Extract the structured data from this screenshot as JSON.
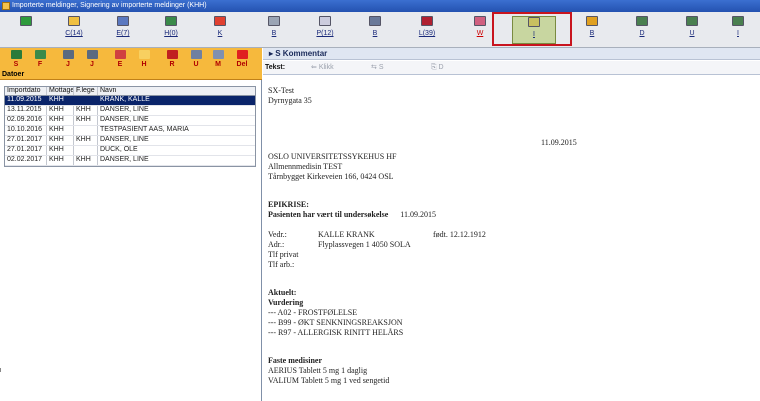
{
  "window": {
    "title": "Importerte meldinger, Signering av importerte meldinger (KHH)"
  },
  "toolbar": {
    "buttons": [
      {
        "label": ""
      },
      {
        "label": "C(14)"
      },
      {
        "label": "E(7)"
      },
      {
        "label": "H(0)"
      },
      {
        "label": "K"
      },
      {
        "label": "B"
      },
      {
        "label": "P(12)"
      },
      {
        "label": "B"
      },
      {
        "label": "L(39)"
      },
      {
        "label": "W"
      },
      {
        "label": "I"
      },
      {
        "label": "B"
      },
      {
        "label": "D"
      },
      {
        "label": "U"
      },
      {
        "label": "I"
      }
    ]
  },
  "left_toolbar": {
    "buttons": [
      {
        "label": "S"
      },
      {
        "label": "F"
      },
      {
        "label": "J"
      },
      {
        "label": "J"
      },
      {
        "label": "E"
      },
      {
        "label": "H"
      },
      {
        "label": "R"
      },
      {
        "label": "U"
      },
      {
        "label": "M"
      },
      {
        "label": "Del"
      }
    ],
    "section_label": "Datoer"
  },
  "grid": {
    "columns": [
      "Importdato",
      "Mottager",
      "F.lege",
      "Navn"
    ],
    "rows": [
      {
        "date": "11.09.2015",
        "mottager": "KHH",
        "flege": "",
        "navn": "KRANK, KALLE",
        "selected": true
      },
      {
        "date": "13.11.2015",
        "mottager": "KHH",
        "flege": "KHH",
        "navn": "DANSER, LINE"
      },
      {
        "date": "02.09.2016",
        "mottager": "KHH",
        "flege": "KHH",
        "navn": "DANSER, LINE"
      },
      {
        "date": "10.10.2016",
        "mottager": "KHH",
        "flege": "",
        "navn": "TESTPASIENT AAS, MARIA"
      },
      {
        "date": "27.01.2017",
        "mottager": "KHH",
        "flege": "KHH",
        "navn": "DANSER, LINE"
      },
      {
        "date": "27.01.2017",
        "mottager": "KHH",
        "flege": "",
        "navn": "DUCK, OLE"
      },
      {
        "date": "02.02.2017",
        "mottager": "KHH",
        "flege": "KHH",
        "navn": "DANSER, LINE"
      }
    ]
  },
  "comment_bar": {
    "label": "S Kommentar"
  },
  "text_bar": {
    "label": "Tekst:",
    "btn1": "Klikk",
    "btn2": "S",
    "btn3": "D"
  },
  "document": {
    "sender_line1": "SX-Test",
    "sender_line2": "Dyrnygata 35",
    "date": "11.09.2015",
    "hospital": "OSLO UNIVERSITETSSYKEHUS HF",
    "dept": "Allmennmedisin TEST",
    "address": "Tårnbygget Kirkeveien 166, 0424 OSL",
    "epikrise_title": "EPIKRISE:",
    "exam_label": "Pasienten har vært til undersøkelse",
    "exam_date": "11.09.2015",
    "vedr_label": "Vedr.:",
    "vedr_name": "KALLE KRANK",
    "born": "født. 12.12.1912",
    "adr_label": "Adr.:",
    "adr_value": "Flyplassvegen 1 4050 SOLA",
    "tlf_privat": "Tlf privat",
    "tlf_arb": "Tlf arb.:",
    "aktuelt": "Aktuelt:",
    "vurdering": "Vurdering",
    "diag1": "--- A02 - FROSTFØLELSE",
    "diag2": "--- B99 - ØKT SENKNINGSREAKSJON",
    "diag3": "--- R97 - ALLERGISK RINITT HELÅRS",
    "faste": "Faste medisiner",
    "med1": "AERIUS Tablett 5 mg 1 daglig",
    "med2": "VALIUM Tablett 5 mg 1 ved sengetid"
  }
}
